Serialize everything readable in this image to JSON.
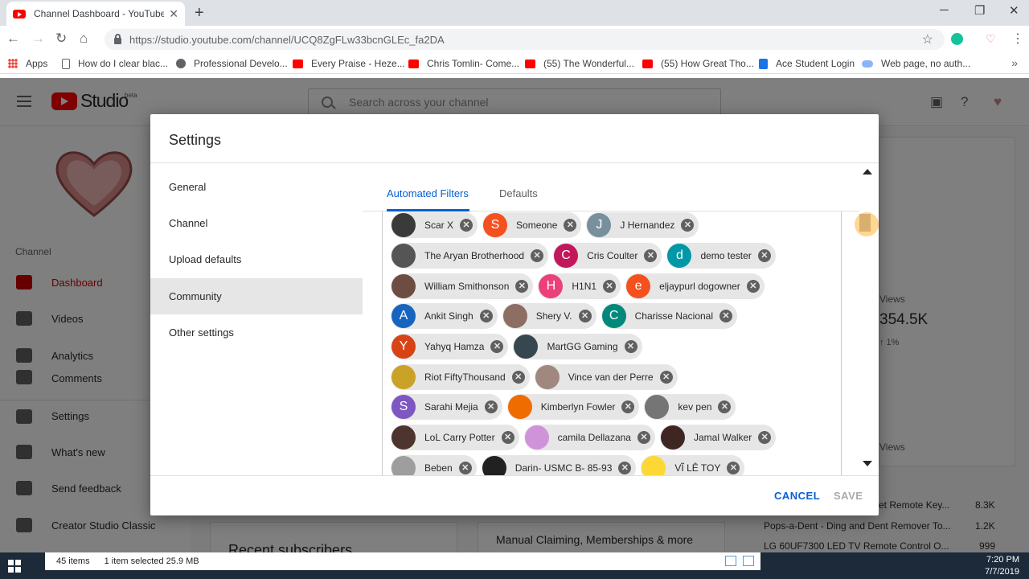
{
  "browser": {
    "tab_title": "Channel Dashboard - YouTube Studio",
    "url": "https://studio.youtube.com/channel/UCQ8ZgFLw33bcnGLEc_fa2DA",
    "bookmarks": [
      {
        "label": "Apps",
        "icon": "apps-grid-icon"
      },
      {
        "label": "How do I clear blac...",
        "icon": "page-icon"
      },
      {
        "label": "Professional Develo...",
        "icon": "globe-icon"
      },
      {
        "label": "Every Praise - Heze...",
        "icon": "youtube-icon"
      },
      {
        "label": "Chris Tomlin- Come...",
        "icon": "youtube-icon"
      },
      {
        "label": "(55) The Wonderful...",
        "icon": "youtube-icon"
      },
      {
        "label": "(55) How Great Tho...",
        "icon": "youtube-icon"
      },
      {
        "label": "Ace Student Login",
        "icon": "ace-icon"
      },
      {
        "label": "Web page, no auth...",
        "icon": "cloud-icon"
      }
    ]
  },
  "studio": {
    "search_placeholder": "Search across your channel",
    "logo_text": "Studio",
    "logo_badge": "beta",
    "section_label": "Channel",
    "sidebar": [
      {
        "label": "Dashboard",
        "active": true
      },
      {
        "label": "Videos"
      },
      {
        "label": "Analytics"
      },
      {
        "label": "Comments"
      },
      {
        "label": "Settings"
      },
      {
        "label": "What's new"
      },
      {
        "label": "Send feedback"
      },
      {
        "label": "Creator Studio Classic"
      }
    ],
    "bg": {
      "views_label": "Views",
      "views_value": "354.5K",
      "views_change": "↑ 1%",
      "views_label2": "Views",
      "recent_subscribers": "Recent subscribers",
      "manual_claiming": "Manual Claiming, Memberships & more",
      "top_rows": [
        {
          "title": "et Remote Key...",
          "views": "8.3K"
        },
        {
          "title": "Pops-a-Dent - Ding and Dent Remover To...",
          "views": "1.2K"
        },
        {
          "title": "LG 60UF7300 LED TV Remote Control O...",
          "views": "999"
        }
      ]
    }
  },
  "dialog": {
    "title": "Settings",
    "nav": [
      "General",
      "Channel",
      "Upload defaults",
      "Community",
      "Other settings"
    ],
    "selected_nav": "Community",
    "tabs": [
      "Automated Filters",
      "Defaults"
    ],
    "active_tab": "Automated Filters",
    "chips": [
      [
        {
          "name": "Scar X",
          "initial": "",
          "color": "#3a3a3a"
        },
        {
          "name": "Someone",
          "initial": "S",
          "color": "#f4511e"
        },
        {
          "name": "J Hernandez",
          "initial": "J",
          "color": "#78909c"
        }
      ],
      [
        {
          "name": "The Aryan Brotherhood",
          "initial": "",
          "color": "#555555"
        },
        {
          "name": "Cris Coulter",
          "initial": "C",
          "color": "#c2185b"
        },
        {
          "name": "demo tester",
          "initial": "d",
          "color": "#0097a7"
        }
      ],
      [
        {
          "name": "William Smithonson",
          "initial": "",
          "color": "#6d4c41"
        },
        {
          "name": "H1N1",
          "initial": "H",
          "color": "#ec407a"
        },
        {
          "name": "eljaypurl dogowner",
          "initial": "e",
          "color": "#f4511e"
        }
      ],
      [
        {
          "name": "Ankit Singh",
          "initial": "A",
          "color": "#1565c0"
        },
        {
          "name": "Shery V.",
          "initial": "",
          "color": "#8d6e63"
        },
        {
          "name": "Charisse Nacional",
          "initial": "C",
          "color": "#00897b"
        }
      ],
      [
        {
          "name": "Yahyq Hamza",
          "initial": "Y",
          "color": "#d84315"
        },
        {
          "name": "MartGG Gaming",
          "initial": "",
          "color": "#37474f"
        }
      ],
      [
        {
          "name": "Riot FiftyThousand",
          "initial": "",
          "color": "#c9a227"
        },
        {
          "name": "Vince van der Perre",
          "initial": "",
          "color": "#a1887f"
        }
      ],
      [
        {
          "name": "Sarahi Mejia",
          "initial": "S",
          "color": "#7e57c2"
        },
        {
          "name": "Kimberlyn Fowler",
          "initial": "",
          "color": "#ef6c00"
        },
        {
          "name": "kev pen",
          "initial": "",
          "color": "#757575"
        }
      ],
      [
        {
          "name": "LoL Carry Potter",
          "initial": "",
          "color": "#4e342e"
        },
        {
          "name": "camila Dellazana",
          "initial": "",
          "color": "#ce93d8"
        },
        {
          "name": "Jamal Walker",
          "initial": "",
          "color": "#3e2723"
        }
      ],
      [
        {
          "name": "Beben",
          "initial": "",
          "color": "#9e9e9e"
        },
        {
          "name": "Darin- USMC B- 85-93",
          "initial": "",
          "color": "#212121"
        },
        {
          "name": "VĨ LÊ TOY",
          "initial": "",
          "color": "#fdd835"
        }
      ]
    ],
    "cancel_label": "CANCEL",
    "save_label": "SAVE"
  },
  "taskbar": {
    "items_count": "45 items",
    "selection": "1 item selected  25.9 MB",
    "time": "7:20 PM",
    "date": "7/7/2019"
  },
  "colors": {
    "accent": "#065fd4",
    "youtube_red": "#ff0000",
    "active_sidebar": "#cc0000"
  }
}
